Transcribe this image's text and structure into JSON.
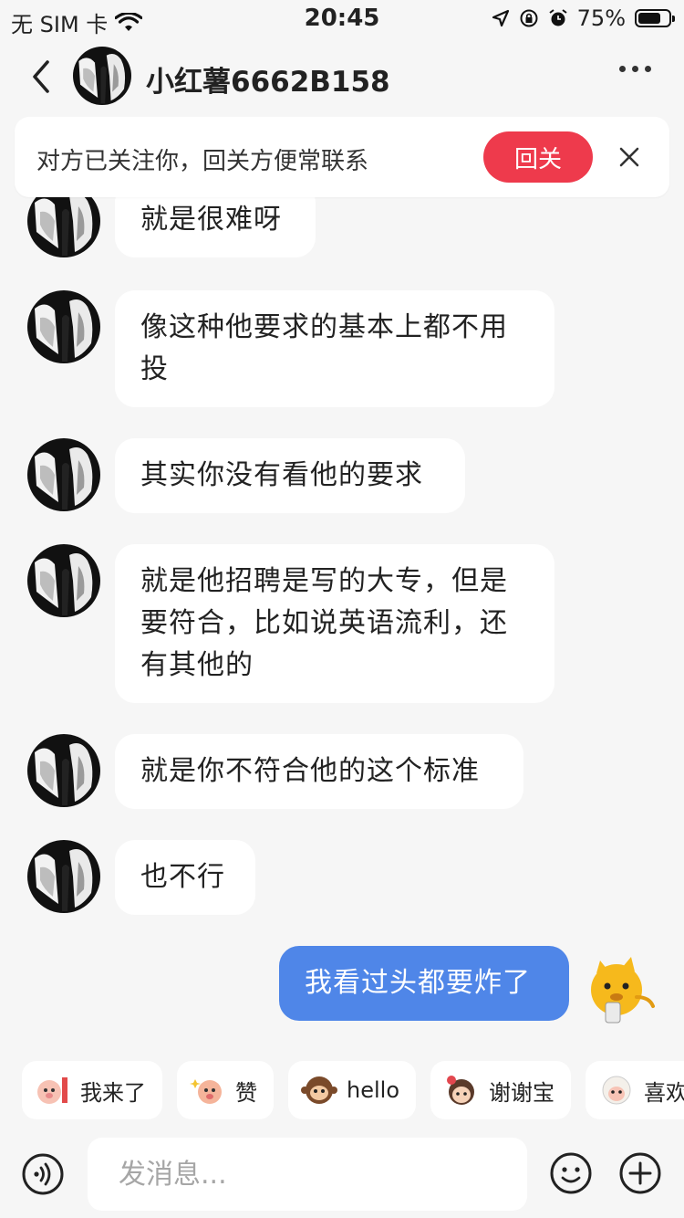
{
  "status_bar": {
    "carrier": "无 SIM 卡",
    "time": "20:45",
    "battery": "75%",
    "battery_level": 0.75
  },
  "header": {
    "title": "小红薯6662B158"
  },
  "follow_banner": {
    "text": "对方已关注你，回关方便常联系",
    "button_label": "回关"
  },
  "messages": [
    {
      "from": "other",
      "text": "就是很难呀"
    },
    {
      "from": "other",
      "text": "像这种他要求的基本上都不用投"
    },
    {
      "from": "other",
      "text": "其实你没有看他的要求"
    },
    {
      "from": "other",
      "text": "就是他招聘是写的大专，但是要符合，比如说英语流利，还有其他的"
    },
    {
      "from": "other",
      "text": "就是你不符合他的这个标准"
    },
    {
      "from": "other",
      "text": "也不行"
    },
    {
      "from": "me",
      "text": "我看过头都要炸了"
    }
  ],
  "quick_stickers": [
    {
      "label": "我来了",
      "icon": "pig-sign-icon"
    },
    {
      "label": "赞",
      "icon": "pig-sparkle-icon"
    },
    {
      "label": "hello",
      "icon": "monkey-icon"
    },
    {
      "label": "谢谢宝",
      "icon": "girl-flower-icon"
    },
    {
      "label": "喜欢",
      "icon": "sheep-icon"
    }
  ],
  "input": {
    "placeholder": "发消息..."
  },
  "colors": {
    "background": "#f6f6f6",
    "accent_red": "#ee3a4c",
    "my_bubble": "#4f86e8"
  }
}
